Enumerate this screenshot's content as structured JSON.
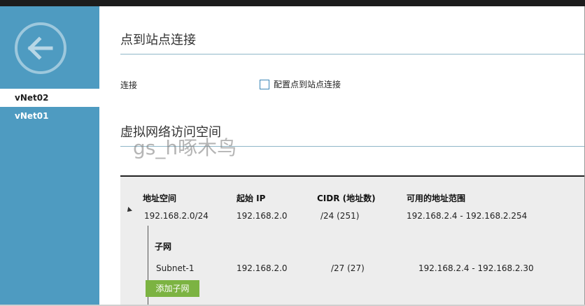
{
  "sidebar": {
    "items": [
      {
        "label": "vNet02",
        "active": true
      },
      {
        "label": "vNet01",
        "active": false
      }
    ]
  },
  "p2s": {
    "title": "点到站点连接",
    "connection_label": "连接",
    "checkbox_label": "配置点到站点连接",
    "checked": false
  },
  "address_space": {
    "title": "虚拟网络访问空间",
    "columns": [
      "地址空间",
      "起始 IP",
      "CIDR (地址数)",
      "可用的地址范围"
    ],
    "row": {
      "space": "192.168.2.0/24",
      "start_ip": "192.168.2.0",
      "cidr": "/24 (251)",
      "range": "192.168.2.4 - 192.168.2.254"
    },
    "subnet_heading": "子网",
    "subnet": {
      "name": "Subnet-1",
      "start_ip": "192.168.2.0",
      "cidr": "/27 (27)",
      "range": "192.168.2.4 - 192.168.2.30"
    },
    "add_subnet_label": "添加子网"
  },
  "watermark": "gs_h啄木鸟",
  "colors": {
    "sidebar": "#4e9bc1",
    "accent_green": "#7cb342",
    "checkbox_border": "#3b86b7"
  }
}
